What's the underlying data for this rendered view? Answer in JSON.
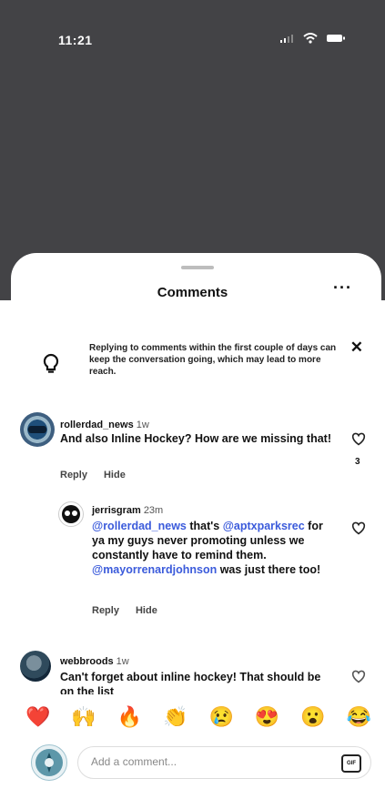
{
  "status_bar": {
    "time": "11:21"
  },
  "header": {
    "title": "Comments",
    "more_label": "···",
    "close_label": "✕"
  },
  "tip": {
    "text": "Replying to comments within the first couple of days can keep the conversation going, which may lead to more reach."
  },
  "comments": [
    {
      "username": "rollerdad_news",
      "time": "1w",
      "text": "And also Inline Hockey? How are we missing that!",
      "reply_label": "Reply",
      "hide_label": "Hide",
      "likes": "3"
    },
    {
      "username": "jerrisgram",
      "time": "23m",
      "mention1": "@rollerdad_news",
      "text1": " that's ",
      "mention2": "@aptxparksrec",
      "text2": " for ya my guys never promoting unless we constantly have to remind them. ",
      "mention3": "@mayorrenardjohnson",
      "text3": " was just there too!",
      "reply_label": "Reply",
      "hide_label": "Hide"
    },
    {
      "username": "webbroods",
      "time": "1w",
      "text": "Can't forget about inline hockey! That should be on the list"
    }
  ],
  "reactions": [
    "❤️",
    "🙌",
    "🔥",
    "👏",
    "😢",
    "😍",
    "😮",
    "😂"
  ],
  "composer": {
    "placeholder": "Add a comment...",
    "gif_label": "GIF"
  }
}
